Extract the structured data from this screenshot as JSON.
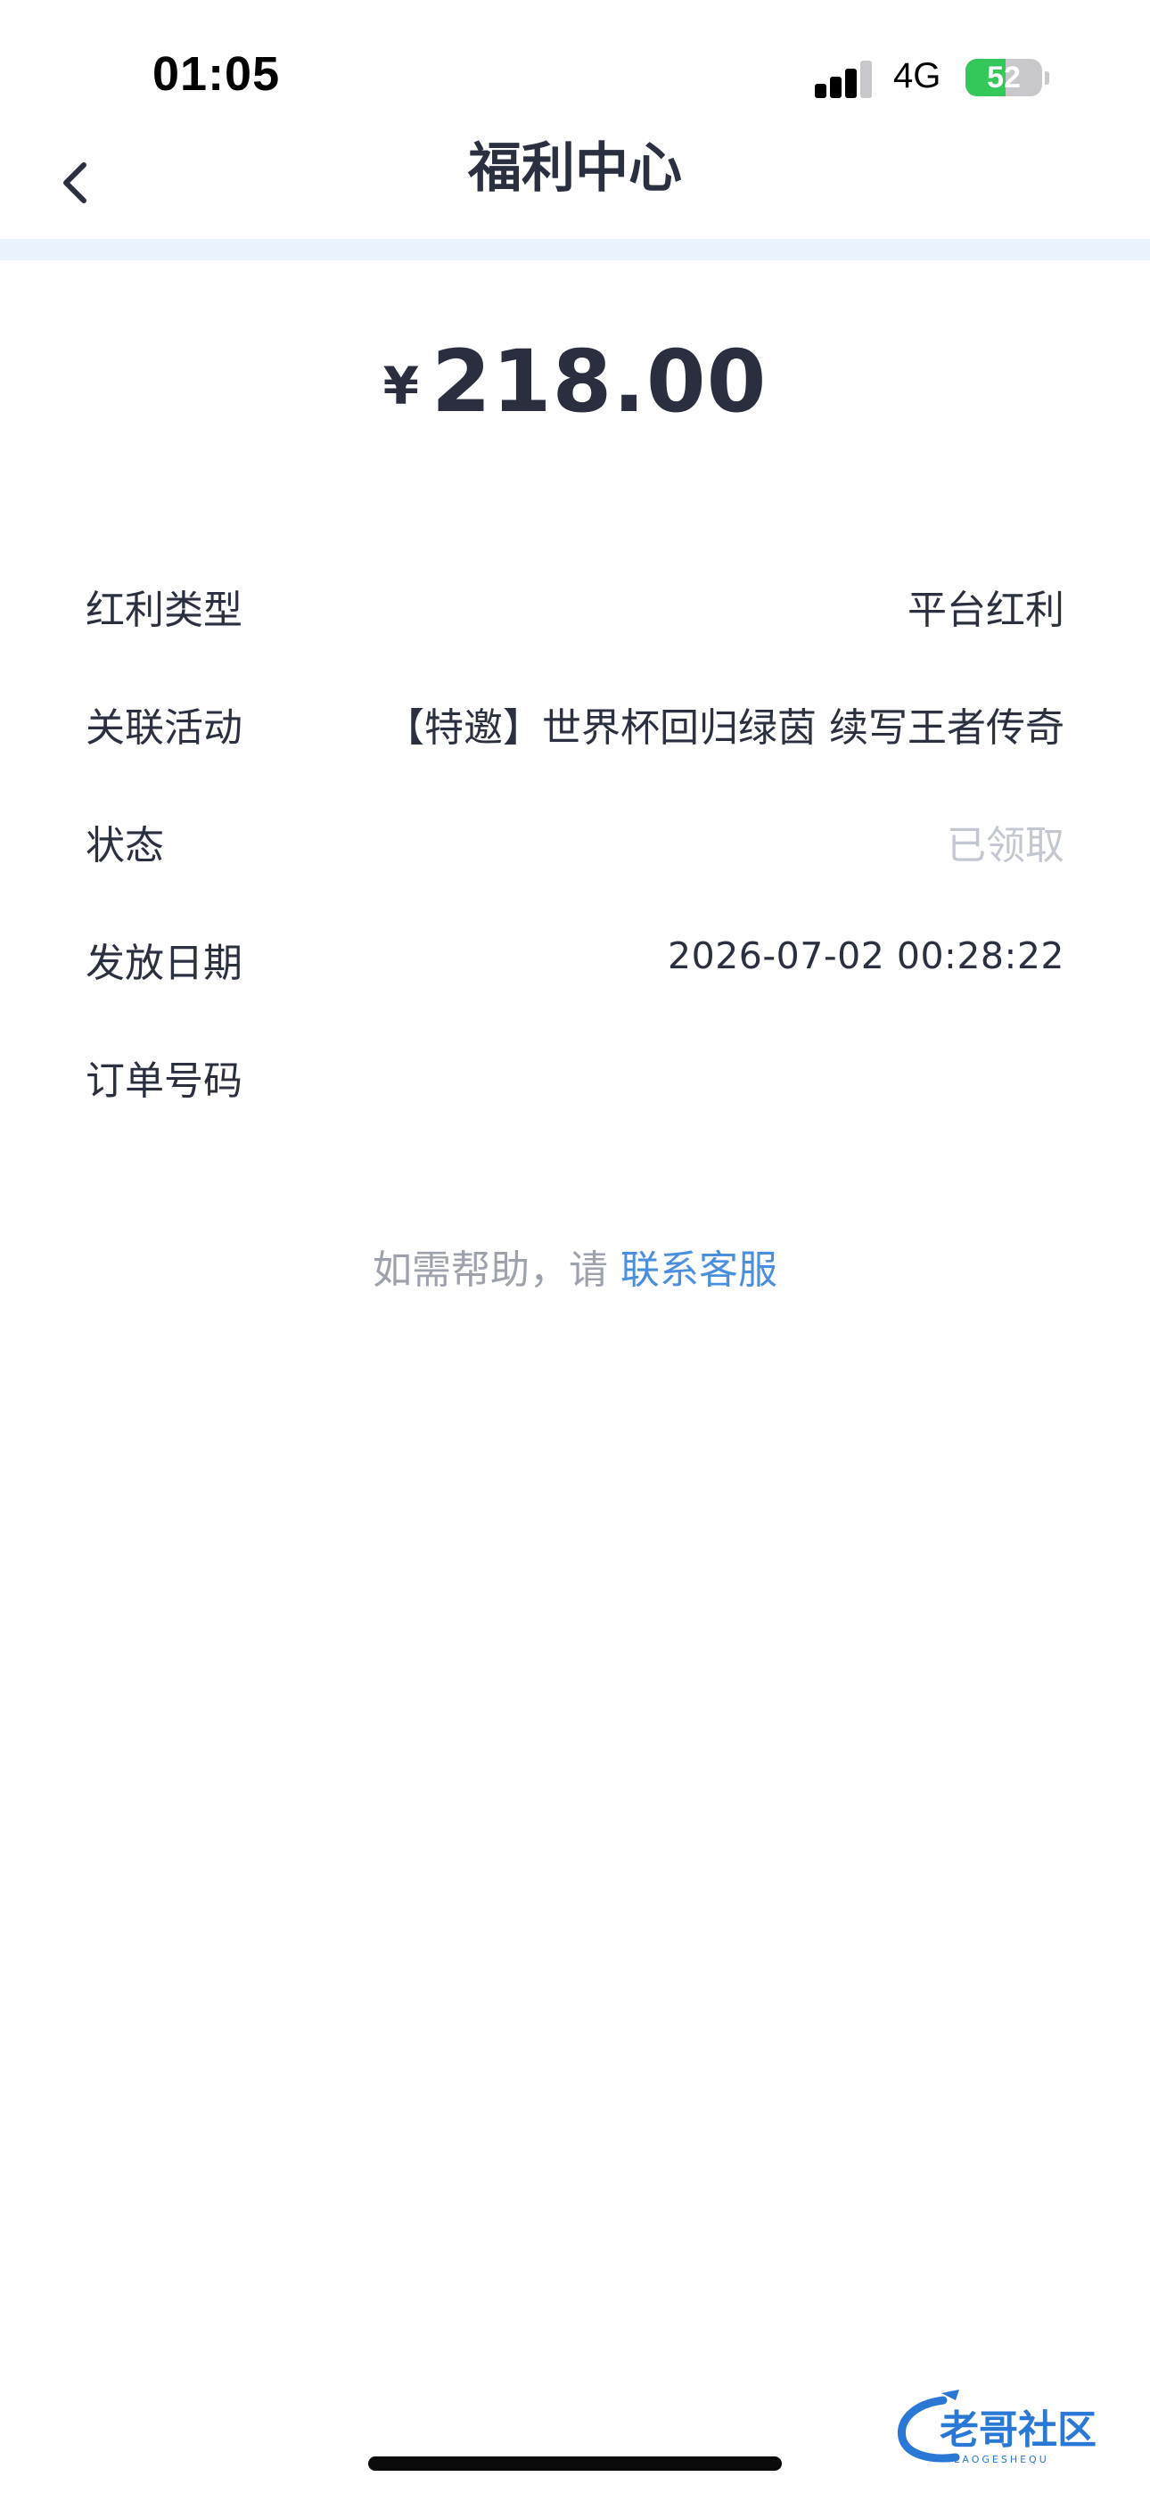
{
  "status_bar": {
    "time": "01:05",
    "network": "4G",
    "battery_percent": "52",
    "battery_level": 0.52
  },
  "nav": {
    "title": "福利中心",
    "back_icon": "chevron-left-icon"
  },
  "amount": {
    "currency": "¥",
    "value": "218.00"
  },
  "details": {
    "rows": [
      {
        "label": "红利类型",
        "value": "平台红利"
      },
      {
        "label": "关联活动",
        "value": "【特邀】世界杯回归绿茵 续写王者传奇"
      },
      {
        "label": "状态",
        "value": "已领取"
      },
      {
        "label": "发放日期",
        "value": "2026-07-02 00:28:22"
      },
      {
        "label": "订单号码",
        "value": ""
      }
    ]
  },
  "help": {
    "prefix": "如需帮助，请",
    "link_label": "联系客服"
  },
  "watermark": {
    "title": "老哥社区",
    "subtitle": "LAOGESHEQU"
  },
  "colors": {
    "accent_link": "#4a8fdd",
    "muted_text": "#c3c7d1",
    "divider_band": "#e8f3fd",
    "battery_green": "#34c759"
  }
}
